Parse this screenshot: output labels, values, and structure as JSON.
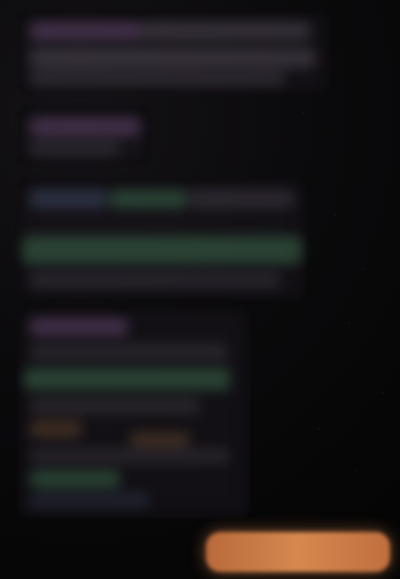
{
  "colors": {
    "background": "#060606",
    "accent_button": "#d6884f",
    "text_purple": "#9b6eaa",
    "text_green": "#46825a",
    "text_brown": "#8c643c",
    "text_blue": "#5a6e96"
  },
  "ui": {
    "primary_action_label": ""
  }
}
